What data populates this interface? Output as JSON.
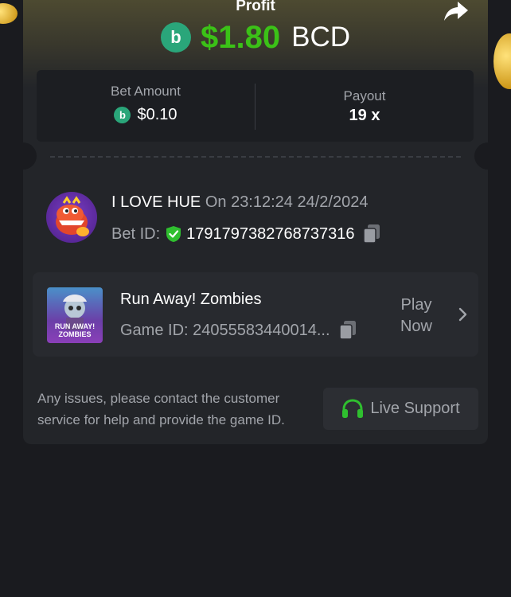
{
  "header": {
    "profit_label": "Profit",
    "profit_amount": "$1.80",
    "profit_currency": "BCD",
    "coin_glyph": "b"
  },
  "stats": {
    "bet_amount_label": "Bet Amount",
    "bet_amount_value": "$0.10",
    "payout_label": "Payout",
    "payout_value": "19 x"
  },
  "user": {
    "name": "I LOVE HUE",
    "on_text": "On 23:12:24 24/2/2024",
    "bet_id_label": "Bet ID:",
    "bet_id": "1791797382768737316"
  },
  "game": {
    "name": "Run Away! Zombies",
    "game_id_text": "Game ID: 24055583440014...",
    "thumb_text": "RUN AWAY! ZOMBIES",
    "play_label": "Play Now"
  },
  "footer": {
    "issues_text": "Any issues, please contact the customer service for help and provide the game ID.",
    "live_support_label": "Live Support"
  },
  "colors": {
    "profit_green": "#3bc117",
    "coin_green": "#2aa67a",
    "verified_green": "#2fbf2f",
    "card_bg": "#232529",
    "page_bg": "#1a1b1f"
  },
  "icons": [
    "share-icon",
    "coin-icon",
    "verified-shield-icon",
    "copy-icon",
    "chevron-right-icon",
    "headset-icon"
  ]
}
